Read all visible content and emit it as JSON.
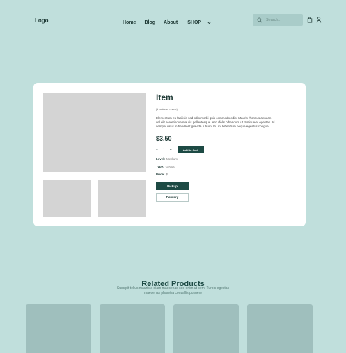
{
  "header": {
    "logo": "Logo",
    "nav": [
      {
        "label": "Home"
      },
      {
        "label": "Blog"
      },
      {
        "label": "About"
      },
      {
        "label": "SHOP"
      }
    ],
    "search": {
      "placeholder": "Search...",
      "icon": "search-icon"
    },
    "icons": [
      "shopping-bag-icon",
      "user-icon"
    ]
  },
  "product": {
    "title": "Item",
    "reviews": "(1 customer review)",
    "description": "Elementum eu facilisis sed odio morbi quis commodo odio. Mauris rhoncus aenean vel elit scelerisque mauris pellentesque. Arcu felis bibendum ut tristique et egestas. Id semper risus in hendrerit gravida rutrum. Eu mi bibendum neque egestas congue.",
    "price": "$3.50",
    "quantity": {
      "minus": "−",
      "value": "1",
      "plus": "+"
    },
    "add_to_cart": "Add to Cart",
    "specs": [
      {
        "label": "Level:",
        "value": "Medium"
      },
      {
        "label": "Type:",
        "value": "Gecos"
      },
      {
        "label": "Price:",
        "value": "$"
      }
    ],
    "pickup": "Pickup",
    "delivery": "Delivery"
  },
  "related": {
    "title": "Related Products",
    "subtitle": "Suscipit tellus mauris a diam maecenas sed enim ut sem. Turpis egestas maecenas pharetra convallis posuere"
  },
  "colors": {
    "background": "#c0dfdc",
    "accent": "#1d4a44",
    "card": "#ffffff",
    "placeholder": "#d4d4d4"
  }
}
